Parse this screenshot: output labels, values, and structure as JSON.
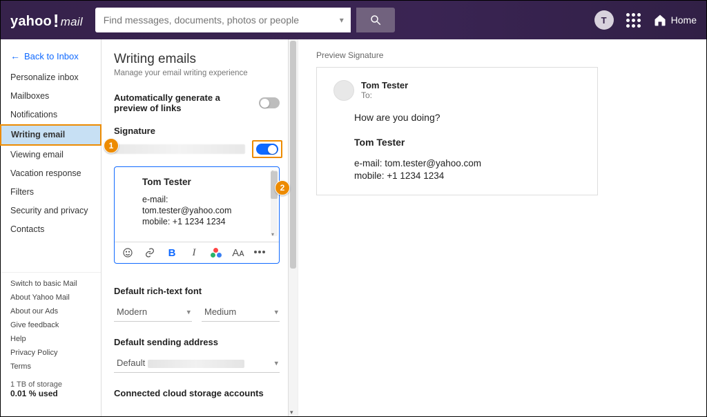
{
  "header": {
    "logo_main": "yahoo",
    "logo_mail": "mail",
    "search_placeholder": "Find messages, documents, photos or people",
    "avatar_initial": "T",
    "home_label": "Home"
  },
  "sidebar": {
    "back_label": "Back to Inbox",
    "items": [
      {
        "label": "Personalize inbox",
        "active": false
      },
      {
        "label": "Mailboxes",
        "active": false
      },
      {
        "label": "Notifications",
        "active": false
      },
      {
        "label": "Writing email",
        "active": true
      },
      {
        "label": "Viewing email",
        "active": false
      },
      {
        "label": "Vacation response",
        "active": false
      },
      {
        "label": "Filters",
        "active": false
      },
      {
        "label": "Security and privacy",
        "active": false
      },
      {
        "label": "Contacts",
        "active": false
      }
    ],
    "small_links": [
      "Switch to basic Mail",
      "About Yahoo Mail",
      "About our Ads",
      "Give feedback",
      "Help",
      "Privacy Policy",
      "Terms"
    ],
    "storage_line1": "1 TB of storage",
    "storage_line2": "0.01 % used"
  },
  "annotations": {
    "step1": "1",
    "step2": "2"
  },
  "settings": {
    "title": "Writing emails",
    "subtitle": "Manage your email writing experience",
    "auto_preview_label": "Automatically generate a preview of links",
    "auto_preview_enabled": false,
    "signature_label": "Signature",
    "signature_enabled": true,
    "signature_editor": {
      "name": "Tom Tester",
      "line_email_key": "e-mail:",
      "line_email_val": "tom.tester@yahoo.com",
      "line_mobile": "mobile: +1 1234 1234",
      "bold_icon": "B",
      "italic_icon": "I",
      "font_icon": "Aᴀ",
      "more_icon": "•••"
    },
    "default_font_label": "Default rich-text font",
    "font_family": "Modern",
    "font_size": "Medium",
    "default_sender_label": "Default sending address",
    "default_sender_value": "Default",
    "cloud_label": "Connected cloud storage accounts"
  },
  "preview": {
    "title": "Preview Signature",
    "from_name": "Tom Tester",
    "to_label": "To:",
    "body": "How are you doing?",
    "sig_name": "Tom Tester",
    "sig_email": "e-mail: tom.tester@yahoo.com",
    "sig_mobile": "mobile: +1 1234 1234"
  }
}
